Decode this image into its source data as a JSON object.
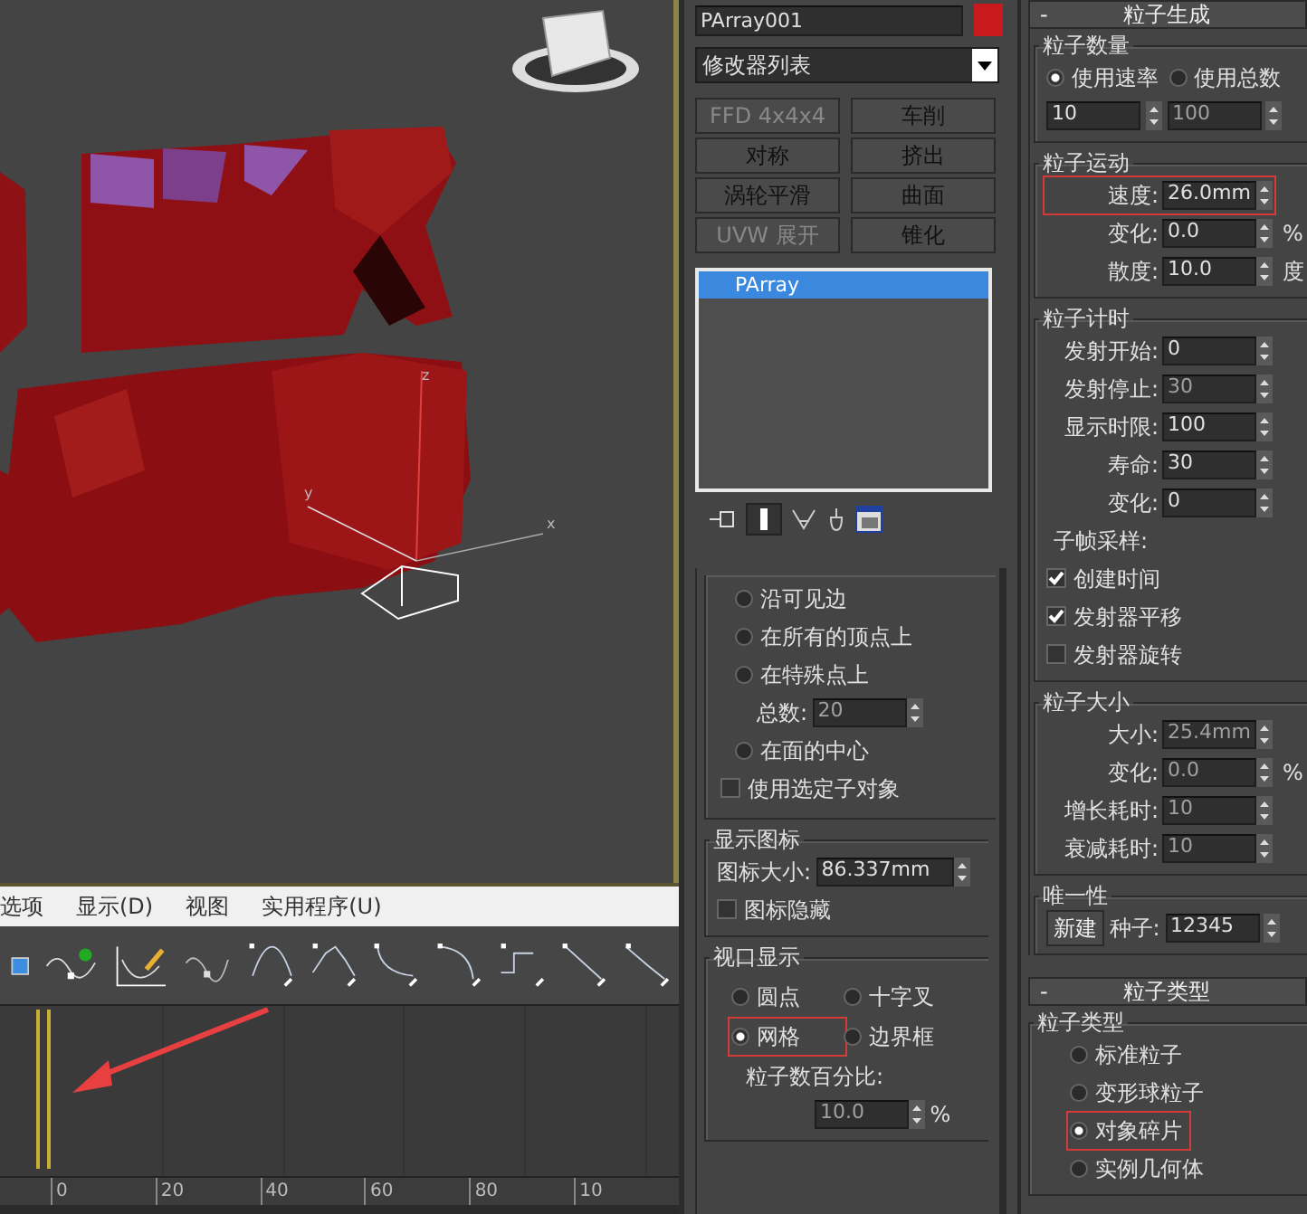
{
  "viewport": {
    "axis_labels": [
      "z",
      "y",
      "x"
    ]
  },
  "curve_editor": {
    "menu": [
      "选项",
      "显示(D)",
      "视图",
      "实用程序(U)"
    ],
    "ruler": [
      "0",
      "20",
      "40",
      "60",
      "80",
      "10"
    ]
  },
  "modifier_panel": {
    "object_name": "PArray001",
    "modifier_list": "修改器列表",
    "buttons": [
      {
        "label": "FFD 4x4x4",
        "disabled": true
      },
      {
        "label": "车削",
        "disabled": false
      },
      {
        "label": "对称",
        "disabled": false
      },
      {
        "label": "挤出",
        "disabled": false
      },
      {
        "label": "涡轮平滑",
        "disabled": false
      },
      {
        "label": "曲面",
        "disabled": false
      },
      {
        "label": "UVW 展开",
        "disabled": true
      },
      {
        "label": "锥化",
        "disabled": false
      }
    ],
    "stack": [
      {
        "label": "PArray",
        "selected": true
      }
    ]
  },
  "emitter_options": {
    "options": [
      {
        "label": "沿可见边",
        "selected": false
      },
      {
        "label": "在所有的顶点上",
        "selected": false
      },
      {
        "label": "在特殊点上",
        "selected": false
      }
    ],
    "total": {
      "label": "总数:",
      "value": "20",
      "disabled": true
    },
    "face_center": {
      "label": "在面的中心",
      "selected": false
    },
    "use_subobjects": {
      "label": "使用选定子对象",
      "checked": false
    }
  },
  "display_icon": {
    "title": "显示图标",
    "size_label": "图标大小:",
    "size_value": "86.337mm",
    "hide": {
      "label": "图标隐藏",
      "checked": false
    }
  },
  "viewport_display": {
    "title": "视口显示",
    "options": [
      {
        "label": "圆点",
        "selected": false
      },
      {
        "label": "十字叉",
        "selected": false
      },
      {
        "label": "网格",
        "selected": true,
        "highlighted": true
      },
      {
        "label": "边界框",
        "selected": false
      }
    ],
    "percent_label": "粒子数百分比:",
    "percent_value": "10.0",
    "percent_unit": "%",
    "percent_disabled": true
  },
  "particle_generation": {
    "collapse": "-",
    "title": "粒子生成",
    "quantity": {
      "title": "粒子数量",
      "options": [
        {
          "label": "使用速率",
          "selected": true
        },
        {
          "label": "使用总数",
          "selected": false
        }
      ],
      "fields": [
        {
          "value": "10",
          "disabled": false
        },
        {
          "value": "100",
          "disabled": true
        }
      ]
    },
    "motion": {
      "title": "粒子运动",
      "fields": [
        {
          "label": "速度:",
          "value": "26.0mm",
          "highlighted": true,
          "disabled": false
        },
        {
          "label": "变化:",
          "value": "0.0",
          "unit": "%",
          "disabled": false
        },
        {
          "label": "散度:",
          "value": "10.0",
          "unit": "度",
          "disabled": false
        }
      ]
    },
    "timing": {
      "title": "粒子计时",
      "fields": [
        {
          "label": "发射开始:",
          "value": "0",
          "disabled": false
        },
        {
          "label": "发射停止:",
          "value": "30",
          "disabled": true
        },
        {
          "label": "显示时限:",
          "value": "100",
          "disabled": false
        },
        {
          "label": "寿命:",
          "value": "30",
          "disabled": false
        },
        {
          "label": "变化:",
          "value": "0",
          "disabled": false
        }
      ],
      "subframe_label": "子帧采样:",
      "checks": [
        {
          "label": "创建时间",
          "checked": true
        },
        {
          "label": "发射器平移",
          "checked": true
        },
        {
          "label": "发射器旋转",
          "checked": false
        }
      ]
    },
    "size": {
      "title": "粒子大小",
      "fields": [
        {
          "label": "大小:",
          "value": "25.4mm",
          "disabled": true
        },
        {
          "label": "变化:",
          "value": "0.0",
          "unit": "%",
          "disabled": true
        },
        {
          "label": "增长耗时:",
          "value": "10",
          "disabled": true
        },
        {
          "label": "衰减耗时:",
          "value": "10",
          "disabled": true
        }
      ]
    },
    "uniqueness": {
      "title": "唯一性",
      "button": "新建",
      "seed_label": "种子:",
      "seed_value": "12345"
    }
  },
  "particle_type": {
    "collapse": "-",
    "title": "粒子类型",
    "group_title": "粒子类型",
    "options": [
      {
        "label": "标准粒子",
        "selected": false
      },
      {
        "label": "变形球粒子",
        "selected": false
      },
      {
        "label": "对象碎片",
        "selected": true,
        "highlighted": true
      },
      {
        "label": "实例几何体",
        "selected": false
      }
    ]
  }
}
